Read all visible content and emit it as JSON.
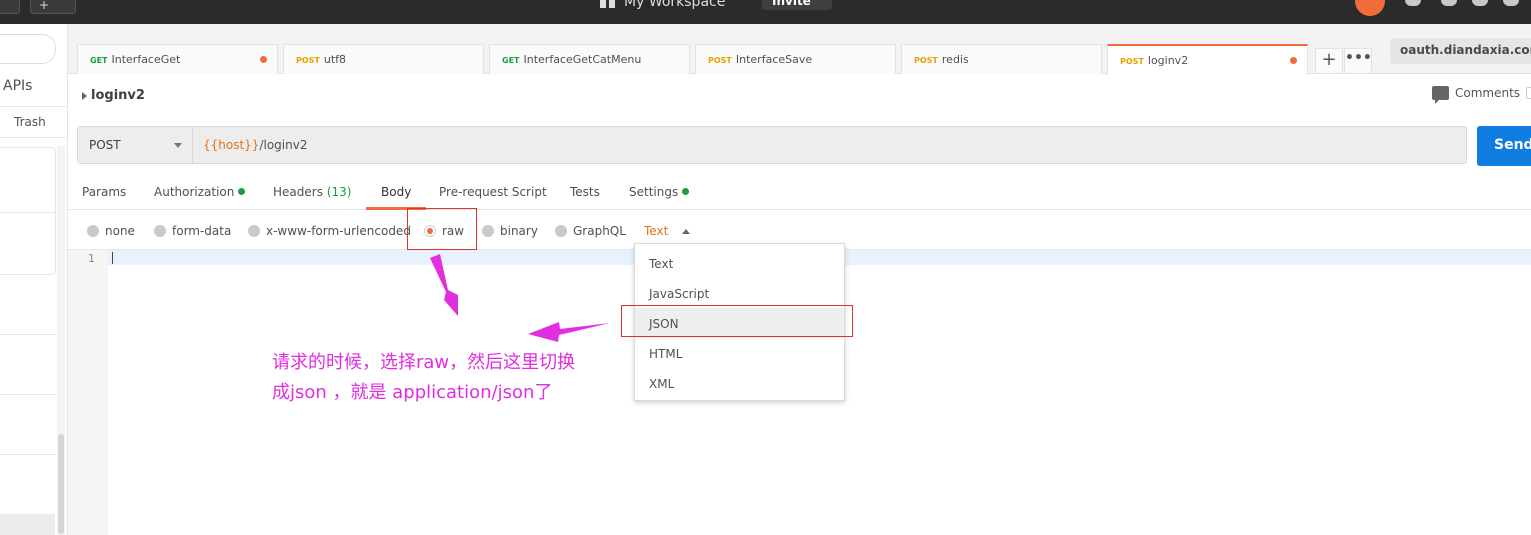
{
  "topbar": {
    "left_button": "+",
    "workspace": "My Workspace",
    "invite": "Invite"
  },
  "sidebar": {
    "apis_label": "APIs",
    "trash_label": "Trash"
  },
  "tabs": [
    {
      "method": "GET",
      "name": "InterfaceGet"
    },
    {
      "method": "POST",
      "name": "utf8"
    },
    {
      "method": "GET",
      "name": "InterfaceGetCatMenu"
    },
    {
      "method": "POST",
      "name": "InterfaceSave"
    },
    {
      "method": "POST",
      "name": "redis"
    },
    {
      "method": "POST",
      "name": "loginv2"
    }
  ],
  "tab_actions": {
    "add": "+",
    "more": "•••"
  },
  "environment": "oauth.diandaxia.com",
  "request": {
    "title": "loginv2",
    "comments_label": "Comments",
    "method": "POST",
    "url_var": "{{host}}",
    "url_path": "/loginv2",
    "send_label": "Send"
  },
  "subtabs": {
    "params": "Params",
    "authorization": "Authorization",
    "headers": "Headers",
    "headers_count": "(13)",
    "body": "Body",
    "prerequest": "Pre-request Script",
    "tests": "Tests",
    "settings": "Settings"
  },
  "body_types": {
    "none": "none",
    "form_data": "form-data",
    "urlencoded": "x-www-form-urlencoded",
    "raw": "raw",
    "binary": "binary",
    "graphql": "GraphQL",
    "selected_format": "Text"
  },
  "editor": {
    "line_number": "1"
  },
  "format_menu": [
    "Text",
    "JavaScript",
    "JSON",
    "HTML",
    "XML"
  ],
  "annotation": {
    "line1": "请求的时候，选择raw，然后这里切换",
    "line2": "成json ，就是 application/json了"
  },
  "colors": {
    "accent": "#f26b3a",
    "send": "#0f7ee0",
    "annotation": "#e02ee0",
    "highlight_box": "#e03030"
  }
}
